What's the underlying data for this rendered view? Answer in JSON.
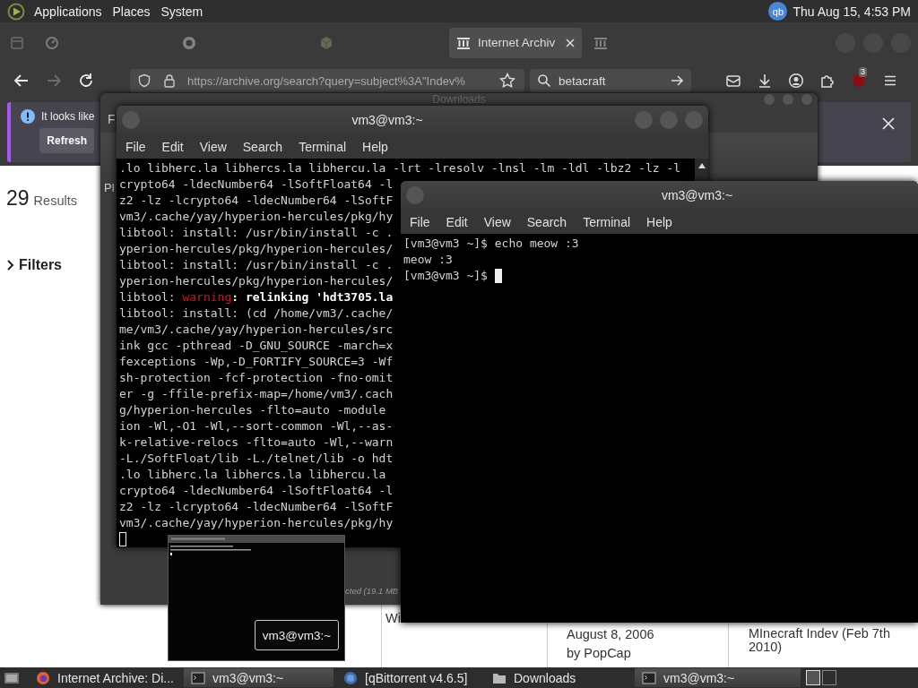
{
  "top_panel": {
    "menus": [
      "Applications",
      "Places",
      "System"
    ],
    "tray_icon": "qb",
    "clock": "Thu Aug 15, 4:53 PM"
  },
  "browser": {
    "tabs": [
      {
        "selected": false
      },
      {
        "selected": false
      },
      {
        "selected": false
      },
      {
        "label": "Internet Archiv",
        "selected": true
      },
      {
        "selected": false
      }
    ],
    "url": "https://archive.org/search?query=subject%3A\"Indev%",
    "search": "betacraft",
    "extension_badge": "3",
    "notification": {
      "message": "It looks like",
      "button": "Refresh"
    },
    "results": {
      "count": "29",
      "label": "Results"
    },
    "filters": "Filters",
    "cards": [
      {
        "lines": [
          "Wi"
        ]
      },
      {
        "lines": [
          "August 8, 2006",
          "by PopCap"
        ]
      },
      {
        "lines": [
          "MInecraft Indev (Feb 7th 2010)"
        ]
      }
    ]
  },
  "downloads_window": {
    "title": "Downloads",
    "menu_fragment": "F",
    "row_fragment": "Pl",
    "status_fragment": "cted (19.1 MB"
  },
  "terminals": [
    {
      "title": "vm3@vm3:~",
      "menu": [
        "File",
        "Edit",
        "View",
        "Search",
        "Terminal",
        "Help"
      ],
      "scrollbar": true,
      "cursor_on_new_line": true,
      "lines": [
        ".lo libherc.la libhercs.la libhercu.la -lrt -lresolv -lnsl -lm -ldl -lbz2 -lz -l",
        "crypto64 -ldecNumber64 -lSoftFloat64 -l",
        "z2 -lz -lcrypto64 -ldecNumber64 -lSoftF",
        "vm3/.cache/yay/hyperion-hercules/pkg/hy",
        "libtool: install: /usr/bin/install -c .",
        "yperion-hercules/pkg/hyperion-hercules/",
        "libtool: install: /usr/bin/install -c .",
        "yperion-hercules/pkg/hyperion-hercules/",
        {
          "parts": [
            {
              "text": "libtool: ",
              "kind": "plain"
            },
            {
              "text": "warning",
              "kind": "warning"
            },
            {
              "text": ": relinking 'hdt3705.la",
              "kind": "bold"
            }
          ]
        },
        "libtool: install: (cd /home/vm3/.cache/",
        "me/vm3/.cache/yay/hyperion-hercules/src",
        "ink gcc -pthread -D_GNU_SOURCE -march=x",
        "fexceptions -Wp,-D_FORTIFY_SOURCE=3 -Wf",
        "sh-protection -fcf-protection -fno-omit",
        "er -g -ffile-prefix-map=/home/vm3/.cach",
        "g/hyperion-hercules -flto=auto -module",
        "ion -Wl,-O1 -Wl,--sort-common -Wl,--as-",
        "k-relative-relocs -flto=auto -Wl,--warn",
        "-L./SoftFloat/lib -L./telnet/lib -o hdt",
        ".lo libherc.la libhercs.la libhercu.la",
        "crypto64 -ldecNumber64 -lSoftFloat64 -l",
        "z2 -lz -lcrypto64 -ldecNumber64 -lSoftF",
        "vm3/.cache/yay/hyperion-hercules/pkg/hy"
      ]
    },
    {
      "title": "vm3@vm3:~",
      "menu": [
        "File",
        "Edit",
        "View",
        "Search",
        "Terminal",
        "Help"
      ],
      "scrollbar": false,
      "cursor_on_new_line": false,
      "lines": [
        "[vm3@vm3 ~]$ echo meow :3",
        "meow :3",
        "[vm3@vm3 ~]$ "
      ]
    }
  ],
  "preview": {
    "label": "vm3@vm3:~"
  },
  "taskbar": {
    "items": [
      {
        "label": "Internet Archive: Di...",
        "kind": "browser",
        "selected": false
      },
      {
        "label": "vm3@vm3:~",
        "kind": "terminal",
        "selected": true
      },
      {
        "label": "[qBittorrent v4.6.5]",
        "kind": "torrent",
        "selected": false
      },
      {
        "label": "Downloads",
        "kind": "folder",
        "selected": false
      },
      {
        "label": "vm3@vm3:~",
        "kind": "terminal",
        "selected": true
      }
    ]
  }
}
